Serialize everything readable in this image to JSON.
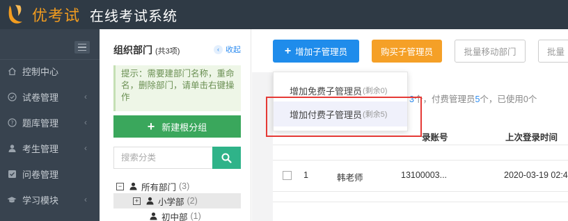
{
  "topbar": {
    "brand": "优考试",
    "title": "在线考试系统"
  },
  "nav": {
    "items": [
      {
        "label": "控制中心",
        "icon": "home-icon",
        "has_arrow": false
      },
      {
        "label": "试卷管理",
        "icon": "check-circle-icon",
        "has_arrow": true
      },
      {
        "label": "题库管理",
        "icon": "question-circle-icon",
        "has_arrow": true
      },
      {
        "label": "考生管理",
        "icon": "user-icon",
        "has_arrow": true
      },
      {
        "label": "问卷管理",
        "icon": "checkbox-icon",
        "has_arrow": false
      },
      {
        "label": "学习模块",
        "icon": "graduation-cap-icon",
        "has_arrow": true
      }
    ],
    "arrow_glyph": "‹"
  },
  "org": {
    "title": "组织部门",
    "count": "(共3项)",
    "collapse_label": "收起",
    "tip": "提示：需要建部门名称，重命名，删除部门，请单击右键操作",
    "new_root_label": "新建根分组",
    "search_placeholder": "搜索分类",
    "tree": [
      {
        "toggle": "−",
        "label": "所有部门",
        "count": "(3)"
      },
      {
        "toggle": "+",
        "label": "小学部",
        "count": "(2)"
      },
      {
        "toggle": "",
        "label": "初中部",
        "count": "(1)"
      }
    ]
  },
  "toolbar": {
    "add_label": "增加子管理员",
    "buy_label": "购买子管理员",
    "move_label": "批量移动部门",
    "more_label": "批量"
  },
  "dropdown": {
    "items": [
      {
        "label": "增加免费子管理员",
        "remain": "(剩余0)"
      },
      {
        "label": "增加付费子管理员",
        "remain": "(剩余5)"
      }
    ]
  },
  "summary": {
    "pre": "",
    "count1": "3",
    "mid": "个，付费管理员",
    "count2": "5",
    "post": "个，已使用0个"
  },
  "table": {
    "headers": {
      "account": "录账号",
      "last_login": "上次登录时间"
    },
    "rows": [
      {
        "index": "1",
        "name": "韩老师",
        "account": "13100003...",
        "last_login": "2020-03-19 02:4"
      }
    ]
  },
  "colors": {
    "topbar": "#2f3a45",
    "nav": "#38434f",
    "brand": "#f29c1f",
    "primary_blue": "#1f8ceb",
    "orange": "#f5a027",
    "green": "#3aa75c",
    "teal": "#2fb389",
    "highlight_red": "#e53935"
  }
}
